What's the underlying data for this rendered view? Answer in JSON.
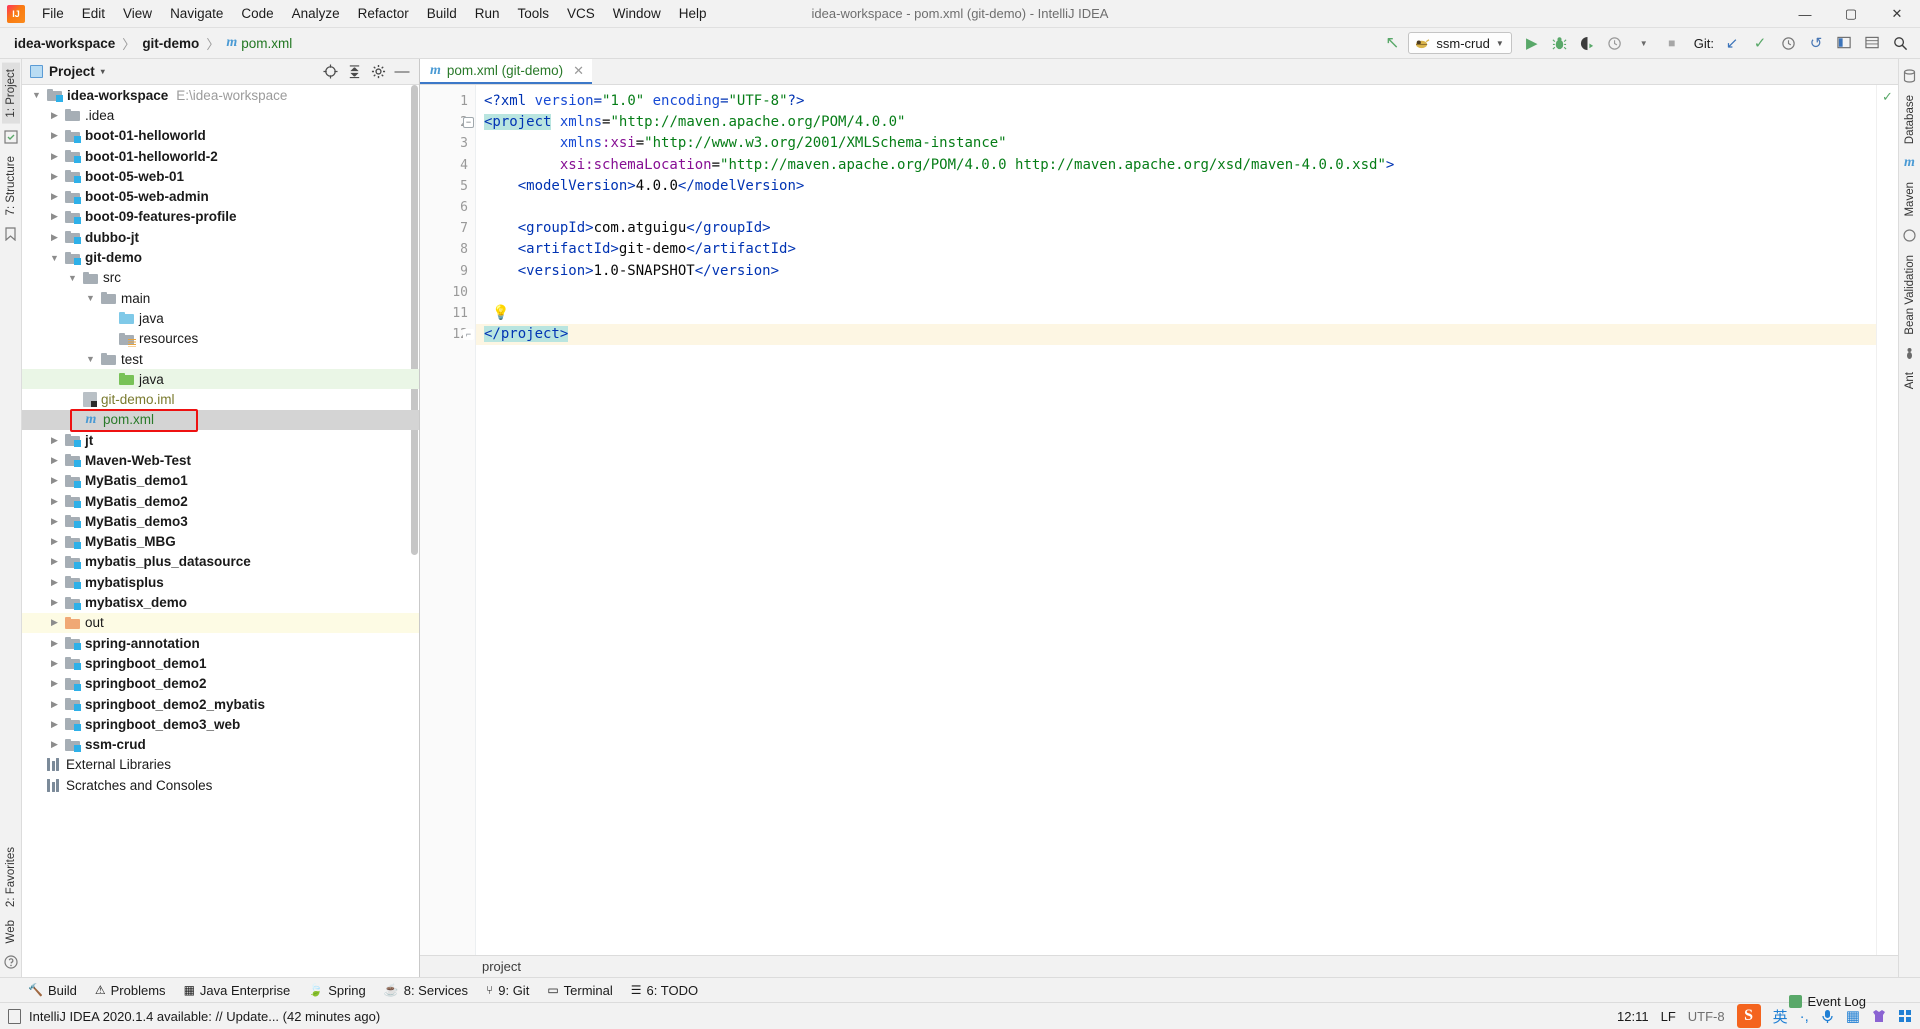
{
  "window": {
    "title": "idea-workspace - pom.xml (git-demo) - IntelliJ IDEA",
    "logo_label": "IJ",
    "minimize": "—",
    "maximize": "▢",
    "close": "✕"
  },
  "menubar": [
    {
      "label": "File"
    },
    {
      "label": "Edit"
    },
    {
      "label": "View"
    },
    {
      "label": "Navigate"
    },
    {
      "label": "Code"
    },
    {
      "label": "Analyze"
    },
    {
      "label": "Refactor"
    },
    {
      "label": "Build"
    },
    {
      "label": "Run"
    },
    {
      "label": "Tools"
    },
    {
      "label": "VCS"
    },
    {
      "label": "Window"
    },
    {
      "label": "Help"
    }
  ],
  "navbar": {
    "crumbs": [
      "idea-workspace",
      "git-demo"
    ],
    "file_crumb": "pom.xml",
    "file_icon": "m",
    "separator": "〉",
    "run_config": "ssm-crud",
    "run_config_icon": "tomcat-icon",
    "git_label": "Git:",
    "icons": [
      {
        "name": "build-arrow-icon",
        "glyph": "↖"
      },
      {
        "name": "run-icon",
        "glyph": "▶"
      },
      {
        "name": "debug-icon",
        "glyph": "🐞"
      },
      {
        "name": "run-with-coverage-icon",
        "glyph": "◗"
      },
      {
        "name": "profiler-icon",
        "glyph": "◷"
      },
      {
        "name": "stop-icon",
        "glyph": "■"
      },
      {
        "name": "git-update-icon",
        "glyph": "↙"
      },
      {
        "name": "git-commit-icon",
        "glyph": "✓"
      },
      {
        "name": "git-history-icon",
        "glyph": "◷"
      },
      {
        "name": "undo-icon",
        "glyph": "↺"
      },
      {
        "name": "select-in-icon",
        "glyph": "▥"
      },
      {
        "name": "settings-icon",
        "glyph": "▤"
      },
      {
        "name": "search-everywhere-icon",
        "glyph": "🔍"
      }
    ]
  },
  "left_strip": {
    "tabs": [
      {
        "label": "1: Project",
        "name": "sidebar-tab-project",
        "selected": true
      },
      {
        "label": "7: Structure",
        "name": "sidebar-tab-structure",
        "selected": false
      },
      {
        "label": "2: Favorites",
        "name": "sidebar-tab-favorites",
        "selected": false
      },
      {
        "label": "Web",
        "name": "sidebar-tab-web",
        "selected": false
      }
    ]
  },
  "right_strip": {
    "tabs": [
      {
        "label": "Database",
        "name": "sidebar-tab-database"
      },
      {
        "label": "Maven",
        "name": "sidebar-tab-maven"
      },
      {
        "label": "Bean Validation",
        "name": "sidebar-tab-bean-validation"
      },
      {
        "label": "Ant",
        "name": "sidebar-tab-ant"
      }
    ]
  },
  "project_panel": {
    "title": "Project",
    "dropdown_caret": "▾",
    "actions": [
      {
        "name": "locate-in-tree-icon",
        "glyph": "⊕"
      },
      {
        "name": "collapse-all-icon",
        "glyph": "⤒"
      },
      {
        "name": "settings-gear-icon",
        "glyph": "✿"
      },
      {
        "name": "hide-panel-icon",
        "glyph": "—"
      }
    ],
    "tree": [
      {
        "label": "idea-workspace",
        "sub": "E:\\idea-workspace",
        "indent": 0,
        "arrow": "open",
        "icon": "module-folder",
        "bold": true
      },
      {
        "label": ".idea",
        "indent": 1,
        "arrow": "closed",
        "icon": "plain-folder",
        "bold": false
      },
      {
        "label": "boot-01-helloworld",
        "indent": 1,
        "arrow": "closed",
        "icon": "module-folder",
        "bold": true
      },
      {
        "label": "boot-01-helloworld-2",
        "indent": 1,
        "arrow": "closed",
        "icon": "module-folder",
        "bold": true
      },
      {
        "label": "boot-05-web-01",
        "indent": 1,
        "arrow": "closed",
        "icon": "module-folder",
        "bold": true
      },
      {
        "label": "boot-05-web-admin",
        "indent": 1,
        "arrow": "closed",
        "icon": "module-folder",
        "bold": true
      },
      {
        "label": "boot-09-features-profile",
        "indent": 1,
        "arrow": "closed",
        "icon": "module-folder",
        "bold": true
      },
      {
        "label": "dubbo-jt",
        "indent": 1,
        "arrow": "closed",
        "icon": "module-folder",
        "bold": true
      },
      {
        "label": "git-demo",
        "indent": 1,
        "arrow": "open",
        "icon": "module-folder",
        "bold": true
      },
      {
        "label": "src",
        "indent": 2,
        "arrow": "open",
        "icon": "plain-folder",
        "bold": false
      },
      {
        "label": "main",
        "indent": 3,
        "arrow": "open",
        "icon": "plain-folder",
        "bold": false
      },
      {
        "label": "java",
        "indent": 4,
        "arrow": "none",
        "icon": "source-folder",
        "bold": false
      },
      {
        "label": "resources",
        "indent": 4,
        "arrow": "none",
        "icon": "resource-folder",
        "bold": false
      },
      {
        "label": "test",
        "indent": 3,
        "arrow": "open",
        "icon": "plain-folder",
        "bold": false
      },
      {
        "label": "java",
        "indent": 4,
        "arrow": "none",
        "icon": "test-source-folder",
        "bold": false,
        "row": "green"
      },
      {
        "label": "git-demo.iml",
        "indent": 2,
        "arrow": "none",
        "icon": "iml-file",
        "bold": false,
        "color": "olive"
      },
      {
        "label": "pom.xml",
        "indent": 2,
        "arrow": "none",
        "icon": "maven-file",
        "bold": false,
        "color": "green",
        "row": "sel",
        "highlight": true
      },
      {
        "label": "jt",
        "indent": 1,
        "arrow": "closed",
        "icon": "module-folder",
        "bold": true
      },
      {
        "label": "Maven-Web-Test",
        "indent": 1,
        "arrow": "closed",
        "icon": "module-folder",
        "bold": true
      },
      {
        "label": "MyBatis_demo1",
        "indent": 1,
        "arrow": "closed",
        "icon": "module-folder",
        "bold": true
      },
      {
        "label": "MyBatis_demo2",
        "indent": 1,
        "arrow": "closed",
        "icon": "module-folder",
        "bold": true
      },
      {
        "label": "MyBatis_demo3",
        "indent": 1,
        "arrow": "closed",
        "icon": "module-folder",
        "bold": true
      },
      {
        "label": "MyBatis_MBG",
        "indent": 1,
        "arrow": "closed",
        "icon": "module-folder",
        "bold": true
      },
      {
        "label": "mybatis_plus_datasource",
        "indent": 1,
        "arrow": "closed",
        "icon": "module-folder",
        "bold": true
      },
      {
        "label": "mybatisplus",
        "indent": 1,
        "arrow": "closed",
        "icon": "module-folder",
        "bold": true
      },
      {
        "label": "mybatisx_demo",
        "indent": 1,
        "arrow": "closed",
        "icon": "module-folder",
        "bold": true
      },
      {
        "label": "out",
        "indent": 1,
        "arrow": "closed",
        "icon": "excluded-folder",
        "bold": false,
        "row": "yellow"
      },
      {
        "label": "spring-annotation",
        "indent": 1,
        "arrow": "closed",
        "icon": "module-folder",
        "bold": true
      },
      {
        "label": "springboot_demo1",
        "indent": 1,
        "arrow": "closed",
        "icon": "module-folder",
        "bold": true
      },
      {
        "label": "springboot_demo2",
        "indent": 1,
        "arrow": "closed",
        "icon": "module-folder",
        "bold": true
      },
      {
        "label": "springboot_demo2_mybatis",
        "indent": 1,
        "arrow": "closed",
        "icon": "module-folder",
        "bold": true
      },
      {
        "label": "springboot_demo3_web",
        "indent": 1,
        "arrow": "closed",
        "icon": "module-folder",
        "bold": true
      },
      {
        "label": "ssm-crud",
        "indent": 1,
        "arrow": "closed",
        "icon": "module-folder",
        "bold": true
      },
      {
        "label": "External Libraries",
        "indent": 0,
        "arrow": "none",
        "icon": "library",
        "bold": false
      },
      {
        "label": "Scratches and Consoles",
        "indent": 0,
        "arrow": "none",
        "icon": "library",
        "bold": false
      }
    ]
  },
  "editor": {
    "tab": {
      "label": "pom.xml (git-demo)",
      "icon": "m",
      "close": "✕"
    },
    "breadcrumb": "project",
    "inspection_ok": "✓",
    "lines": [
      {
        "n": 1,
        "segments": [
          {
            "t": "tag",
            "s": "<?xml "
          },
          {
            "t": "attr",
            "s": "version"
          },
          {
            "t": "tag",
            "s": "="
          },
          {
            "t": "val",
            "s": "\"1.0\""
          },
          {
            "t": "tag",
            "s": " "
          },
          {
            "t": "attr",
            "s": "encoding"
          },
          {
            "t": "tag",
            "s": "="
          },
          {
            "t": "val",
            "s": "\"UTF-8\""
          },
          {
            "t": "tag",
            "s": "?>"
          }
        ],
        "indent": 0
      },
      {
        "n": 2,
        "segments": [
          {
            "t": "sel",
            "s": "<project"
          },
          {
            "t": "plain",
            "s": " "
          },
          {
            "t": "attr",
            "s": "xmlns"
          },
          {
            "t": "plain",
            "s": "="
          },
          {
            "t": "val",
            "s": "\"http://maven.apache.org/POM/4.0.0\""
          }
        ],
        "fold": "open"
      },
      {
        "n": 3,
        "segments": [
          {
            "t": "plain",
            "s": "         "
          },
          {
            "t": "attr",
            "s": "xmlns"
          },
          {
            "t": "ns",
            "s": ":xsi"
          },
          {
            "t": "plain",
            "s": "="
          },
          {
            "t": "val",
            "s": "\"http://www.w3.org/2001/XMLSchema-instance\""
          }
        ]
      },
      {
        "n": 4,
        "segments": [
          {
            "t": "plain",
            "s": "         "
          },
          {
            "t": "ns",
            "s": "xsi:schemaLocation"
          },
          {
            "t": "plain",
            "s": "="
          },
          {
            "t": "val",
            "s": "\"http://maven.apache.org/POM/4.0.0 http://maven.apache.org/xsd/maven-4.0.0.xsd\""
          },
          {
            "t": "tag",
            "s": ">"
          }
        ]
      },
      {
        "n": 5,
        "segments": [
          {
            "t": "plain",
            "s": "    "
          },
          {
            "t": "tag",
            "s": "<modelVersion>"
          },
          {
            "t": "txt",
            "s": "4.0.0"
          },
          {
            "t": "tag",
            "s": "</modelVersion>"
          }
        ]
      },
      {
        "n": 6,
        "segments": []
      },
      {
        "n": 7,
        "segments": [
          {
            "t": "plain",
            "s": "    "
          },
          {
            "t": "tag",
            "s": "<groupId>"
          },
          {
            "t": "txt",
            "s": "com.atguigu"
          },
          {
            "t": "tag",
            "s": "</groupId>"
          }
        ]
      },
      {
        "n": 8,
        "segments": [
          {
            "t": "plain",
            "s": "    "
          },
          {
            "t": "tag",
            "s": "<artifactId>"
          },
          {
            "t": "txt",
            "s": "git-demo"
          },
          {
            "t": "tag",
            "s": "</artifactId>"
          }
        ]
      },
      {
        "n": 9,
        "segments": [
          {
            "t": "plain",
            "s": "    "
          },
          {
            "t": "tag",
            "s": "<version>"
          },
          {
            "t": "txt",
            "s": "1.0-SNAPSHOT"
          },
          {
            "t": "tag",
            "s": "</version>"
          }
        ]
      },
      {
        "n": 10,
        "segments": []
      },
      {
        "n": 11,
        "segments": [],
        "bulb": true
      },
      {
        "n": 12,
        "segments": [
          {
            "t": "sel",
            "s": "</project>"
          }
        ],
        "highlight": true,
        "fold": "end"
      }
    ]
  },
  "bottom_tools": [
    {
      "label": "Build",
      "icon": "hammer-icon",
      "name": "tool-window-build"
    },
    {
      "label": "Problems",
      "icon": "warning-icon",
      "name": "tool-window-problems"
    },
    {
      "label": "Java Enterprise",
      "icon": "java-ee-icon",
      "name": "tool-window-java-enterprise"
    },
    {
      "label": "Spring",
      "icon": "spring-leaf-icon",
      "name": "tool-window-spring"
    },
    {
      "label": "8: Services",
      "icon": "services-icon",
      "name": "tool-window-services"
    },
    {
      "label": "9: Git",
      "icon": "git-branch-icon",
      "name": "tool-window-git"
    },
    {
      "label": "Terminal",
      "icon": "terminal-icon",
      "name": "tool-window-terminal"
    },
    {
      "label": "6: TODO",
      "icon": "todo-icon",
      "name": "tool-window-todo"
    }
  ],
  "statusbar": {
    "message": "IntelliJ IDEA 2020.1.4 available: // Update... (42 minutes ago)",
    "position": "12:11",
    "line_separator": "LF",
    "encoding": "UTF-8",
    "event_log": "Event Log",
    "tray": [
      {
        "name": "sogou-ime-icon",
        "glyph": "S"
      },
      {
        "name": "chinese-input-icon",
        "glyph": "英"
      },
      {
        "name": "punctuation-icon",
        "glyph": "·,"
      },
      {
        "name": "microphone-icon",
        "glyph": "🎤"
      },
      {
        "name": "soft-keyboard-icon",
        "glyph": "▦"
      },
      {
        "name": "skin-icon",
        "glyph": "👕"
      },
      {
        "name": "toolbox-icon",
        "glyph": "⊞"
      }
    ]
  }
}
